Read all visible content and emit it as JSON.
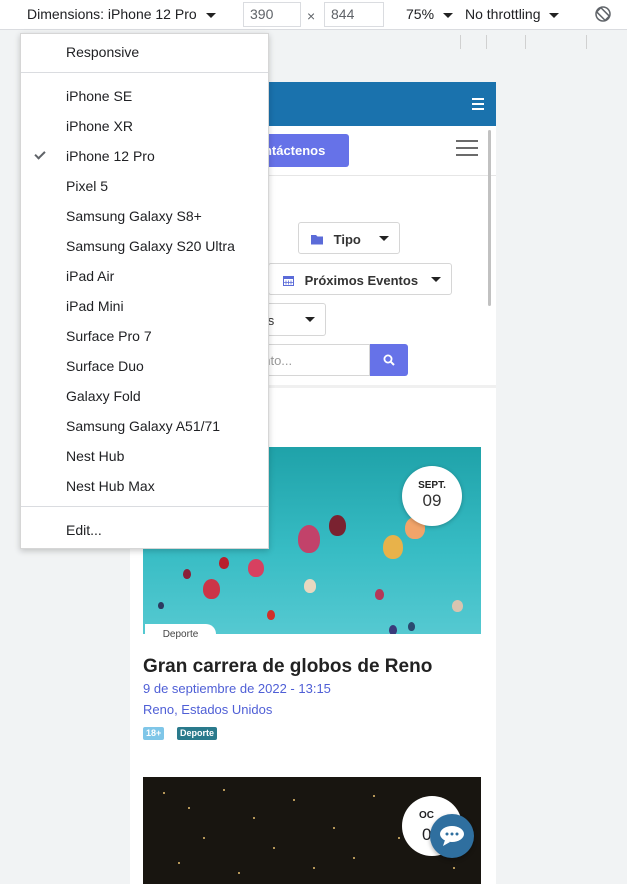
{
  "toolbar": {
    "dimensions_label": "Dimensions: iPhone 12 Pro",
    "width_value": "390",
    "height_value": "844",
    "times": "×",
    "zoom_label": "75%",
    "throttle_label": "No throttling"
  },
  "dropdown": {
    "responsive": "Responsive",
    "devices": [
      "iPhone SE",
      "iPhone XR",
      "iPhone 12 Pro",
      "Pixel 5",
      "Samsung Galaxy S8+",
      "Samsung Galaxy S20 Ultra",
      "iPad Air",
      "iPad Mini",
      "Surface Pro 7",
      "Surface Duo",
      "Galaxy Fold",
      "Samsung Galaxy A51/71",
      "Nest Hub",
      "Nest Hub Max"
    ],
    "selected": "iPhone 12 Pro",
    "edit": "Edit..."
  },
  "page": {
    "contact_button": "ontáctenos",
    "filter_tipo": "Tipo",
    "filter_eventos": "Próximos Eventos",
    "filter_meses_fragment": "ses",
    "search_placeholder_fragment": "ento..."
  },
  "card1": {
    "month": "SEPT.",
    "day": "09",
    "category": "Deporte",
    "title": "Gran carrera de globos de Reno",
    "datetime": "9 de septiembre de 2022 - 13:15",
    "location": "Reno, Estados Unidos",
    "tags": [
      "18+",
      "Deporte"
    ]
  },
  "card2": {
    "month_fragment": "OC",
    "day_fragment": "0"
  },
  "colors": {
    "brand_blue": "#1a72ad",
    "accent_purple": "#6672e8",
    "link_blue": "#4f5fd6",
    "tag_18": "#5bc0de",
    "tag_deporte": "#2a7a8c"
  }
}
